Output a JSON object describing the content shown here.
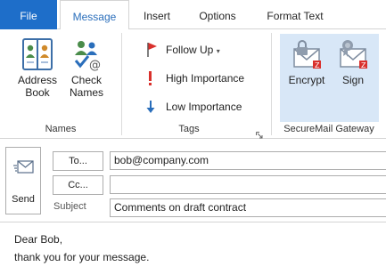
{
  "tabs": {
    "file": "File",
    "message": "Message",
    "insert": "Insert",
    "options": "Options",
    "format_text": "Format Text"
  },
  "ribbon": {
    "names_group": {
      "label": "Names",
      "address_book": "Address\nBook",
      "check_names": "Check\nNames"
    },
    "tags_group": {
      "label": "Tags",
      "follow_up": "Follow Up",
      "high_importance": "High Importance",
      "low_importance": "Low Importance"
    },
    "securemail_group": {
      "label": "SecureMail Gateway",
      "encrypt": "Encrypt",
      "sign": "Sign"
    }
  },
  "compose": {
    "send": "Send",
    "to_button": "To...",
    "cc_button": "Cc...",
    "subject_label": "Subject",
    "to_value": "bob@company.com",
    "cc_value": "",
    "subject_value": "Comments on draft contract"
  },
  "body": {
    "line1": "Dear Bob,",
    "line2": "thank you for your message."
  },
  "colors": {
    "file_tab": "#1e6ec9",
    "active_tab_text": "#2a6ebb",
    "securemail_highlight": "#d8e7f7",
    "follow_up_flag": "#d9302c",
    "high_importance": "#d9302c",
    "low_importance": "#2a6ebb"
  }
}
